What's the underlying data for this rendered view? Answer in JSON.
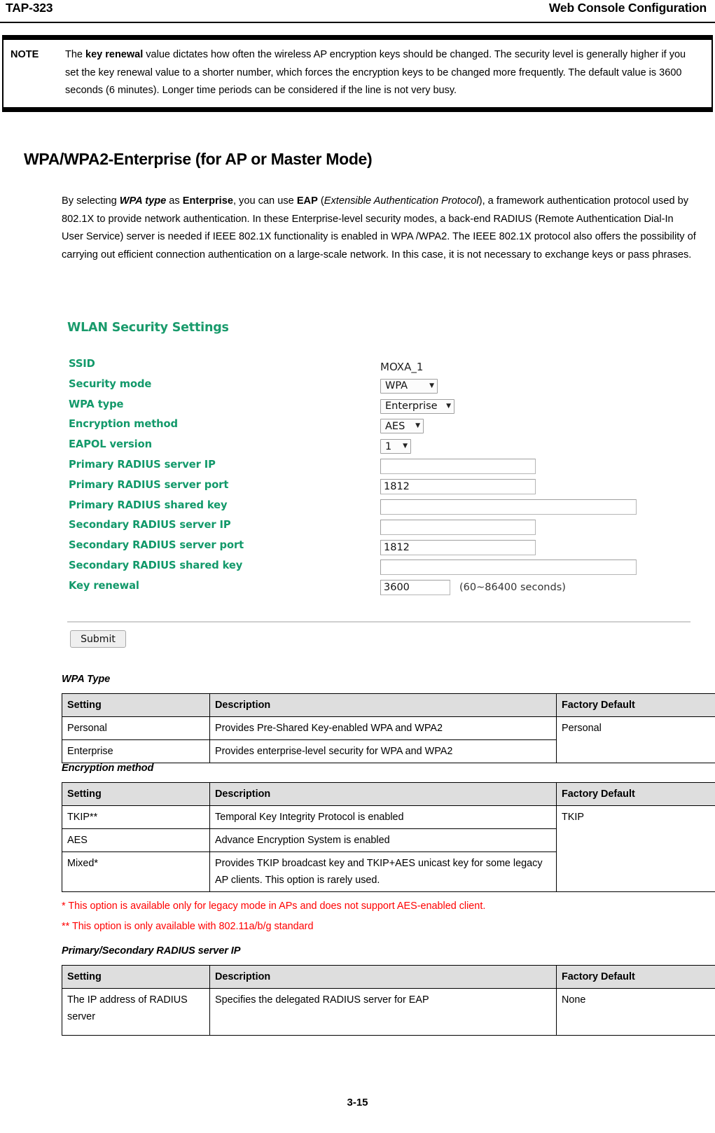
{
  "header": {
    "left": "TAP-323",
    "right": "Web Console Configuration"
  },
  "note": {
    "label": "NOTE",
    "text_part1": "The ",
    "text_bold": "key renewal",
    "text_part2": " value dictates how often the wireless AP encryption keys should be changed. The security level is generally higher if you set the key renewal value to a shorter number, which forces the encryption keys to be changed more frequently. The default value is 3600 seconds (6 minutes). Longer time periods can be considered if the line is not very busy."
  },
  "section": {
    "title": "WPA/WPA2-Enterprise (for AP or Master Mode)",
    "paragraph": {
      "p1": "By selecting ",
      "b1": "WPA type",
      "p2": " as ",
      "b2": "Enterprise",
      "p3": ", you can use ",
      "b3": "EAP",
      "p4": " (",
      "i1": "Extensible Authentication Protocol",
      "p5": "), a framework authentication protocol used by 802.1X to provide network authentication. In these Enterprise-level security modes, a back-end RADIUS (Remote Authentication Dial-In User Service) server is needed if IEEE 802.1X functionality is enabled in WPA /WPA2. The IEEE 802.1X protocol also offers the possibility of carrying out efficient connection authentication on a large-scale network. In this case, it is not necessary to exchange keys or pass phrases."
    }
  },
  "console": {
    "title": "WLAN Security Settings",
    "rows": [
      {
        "label": "SSID",
        "type": "static",
        "value": "MOXA_1"
      },
      {
        "label": "Security mode",
        "type": "select",
        "value": "WPA"
      },
      {
        "label": "WPA type",
        "type": "select",
        "value": "Enterprise"
      },
      {
        "label": "Encryption method",
        "type": "select",
        "value": "AES"
      },
      {
        "label": "EAPOL version",
        "type": "select",
        "value": "1"
      },
      {
        "label": "Primary RADIUS server IP",
        "type": "text",
        "value": ""
      },
      {
        "label": "Primary RADIUS server port",
        "type": "text",
        "value": "1812"
      },
      {
        "label": "Primary RADIUS shared key",
        "type": "text",
        "value": ""
      },
      {
        "label": "Secondary RADIUS server IP",
        "type": "text",
        "value": ""
      },
      {
        "label": "Secondary RADIUS server port",
        "type": "text",
        "value": "1812"
      },
      {
        "label": "Secondary RADIUS shared key",
        "type": "text",
        "value": ""
      },
      {
        "label": "Key renewal",
        "type": "text",
        "value": "3600"
      }
    ],
    "key_renewal_hint": "(60~86400 seconds)",
    "submit_label": "Submit",
    "label_color": "#12996a",
    "title_color": "#1a9b6c"
  },
  "tables": [
    {
      "caption": "WPA Type",
      "headers": [
        "Setting",
        "Description",
        "Factory Default"
      ],
      "rows": [
        [
          "Personal",
          "Provides Pre-Shared Key-enabled WPA and WPA2",
          "Personal"
        ],
        [
          "Enterprise",
          "Provides enterprise-level security for WPA and WPA2",
          ""
        ]
      ]
    },
    {
      "caption": "Encryption method",
      "headers": [
        "Setting",
        "Description",
        "Factory Default"
      ],
      "rows": [
        [
          "TKIP**",
          "Temporal Key Integrity Protocol is enabled",
          "TKIP"
        ],
        [
          "AES",
          "Advance Encryption System is enabled",
          ""
        ],
        [
          "Mixed*",
          "Provides TKIP broadcast key and TKIP+AES unicast key for some legacy AP clients. This option is rarely used.",
          ""
        ]
      ]
    },
    {
      "caption": "Primary/Secondary RADIUS server IP",
      "headers": [
        "Setting",
        "Description",
        "Factory Default"
      ],
      "rows": [
        [
          "The IP address of RADIUS server",
          "Specifies the delegated RADIUS server for EAP",
          "None"
        ]
      ]
    }
  ],
  "footnotes": {
    "one": "* This option is available only for legacy mode in APs and does not support AES-enabled client.",
    "two": "** This option is only available with 802.11a/b/g standard",
    "color": "#ff0000"
  },
  "footer": {
    "page_number": "3-15"
  }
}
